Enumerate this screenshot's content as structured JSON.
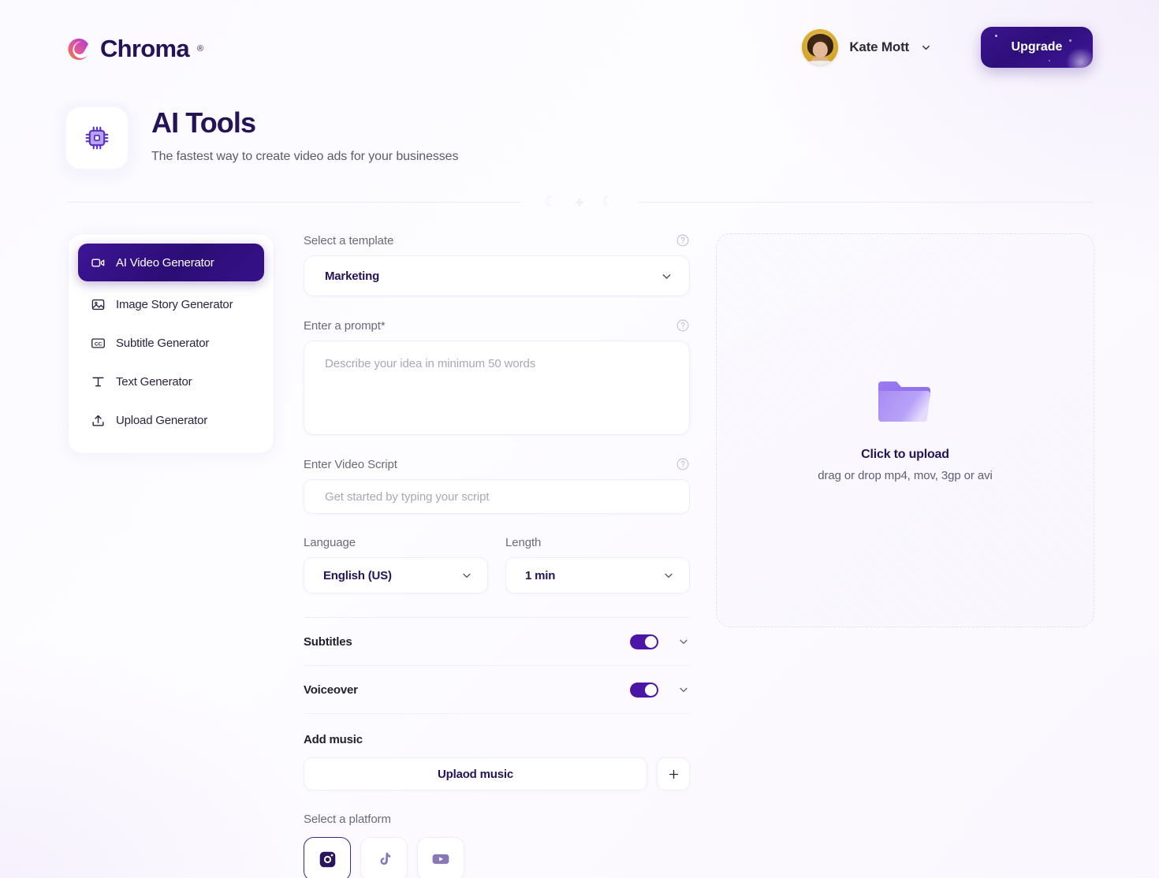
{
  "brand": {
    "name": "Chroma",
    "registered_mark": "®",
    "logo_icon": "chroma-swirl-logo"
  },
  "header": {
    "user": {
      "name": "Kate Mott",
      "avatar_icon": "user-avatar",
      "chevron_icon": "chevron-down-icon"
    },
    "upgrade_label": "Upgrade"
  },
  "page": {
    "icon": "chip-icon",
    "title": "AI Tools",
    "subtitle": "The fastest way to create video ads for your businesses"
  },
  "sidebar": {
    "items": [
      {
        "label": "AI Video Generator",
        "icon": "video-camera-icon",
        "active": true
      },
      {
        "label": "Image Story Generator",
        "icon": "image-icon",
        "active": false
      },
      {
        "label": "Subtitle Generator",
        "icon": "closed-caption-icon",
        "active": false
      },
      {
        "label": "Text Generator",
        "icon": "text-t-icon",
        "active": false
      },
      {
        "label": "Upload Generator",
        "icon": "upload-arrow-icon",
        "active": false
      }
    ]
  },
  "form": {
    "template": {
      "label": "Select a template",
      "value": "Marketing",
      "help_icon": "question-circle-icon",
      "chevron_icon": "chevron-down-icon"
    },
    "prompt": {
      "label": "Enter a prompt*",
      "placeholder": "Describe your idea in minimum 50 words",
      "value": "",
      "help_icon": "question-circle-icon"
    },
    "script": {
      "label": "Enter Video Script",
      "placeholder": "Get started by typing your script",
      "value": "",
      "help_icon": "question-circle-icon"
    },
    "language": {
      "label": "Language",
      "value": "English (US)",
      "chevron_icon": "chevron-down-icon"
    },
    "length": {
      "label": "Length",
      "value": "1 min",
      "chevron_icon": "chevron-down-icon"
    },
    "subtitles": {
      "label": "Subtitles",
      "enabled": true,
      "chevron_icon": "chevron-down-icon"
    },
    "voiceover": {
      "label": "Voiceover",
      "enabled": true,
      "chevron_icon": "chevron-down-icon"
    },
    "music": {
      "label": "Add music",
      "upload_label": "Uplaod music",
      "add_icon": "plus-icon"
    },
    "platform": {
      "label": "Select a platform",
      "options": [
        {
          "name": "Instagram",
          "icon": "instagram-icon",
          "selected": true
        },
        {
          "name": "TikTok",
          "icon": "tiktok-icon",
          "selected": false
        },
        {
          "name": "YouTube",
          "icon": "youtube-icon",
          "selected": false
        }
      ]
    }
  },
  "dropzone": {
    "icon": "folder-icon",
    "title": "Click to upload",
    "subtitle": "drag or drop mp4, mov, 3gp or avi"
  },
  "colors": {
    "brand_purple": "#2e0f7a",
    "accent_violet": "#4b16a8",
    "title_navy": "#241356",
    "muted_text": "#6a6a7a",
    "folder_purple": "#9b7cf0"
  }
}
